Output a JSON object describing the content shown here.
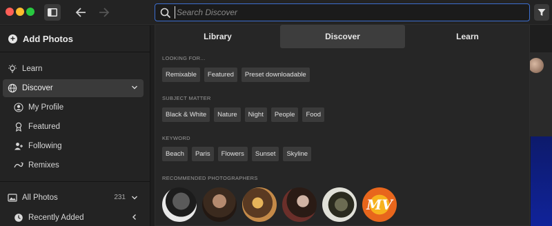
{
  "window": {
    "search_placeholder": "Search Discover"
  },
  "sidebar": {
    "add_photos": "Add Photos",
    "items": [
      {
        "label": "Learn",
        "icon": "lightbulb-icon"
      },
      {
        "label": "Discover",
        "icon": "globe-icon"
      },
      {
        "label": "My Profile",
        "icon": "profile-icon"
      },
      {
        "label": "Featured",
        "icon": "award-icon"
      },
      {
        "label": "Following",
        "icon": "person-add-icon"
      },
      {
        "label": "Remixes",
        "icon": "remix-icon"
      }
    ],
    "all_photos": {
      "label": "All Photos",
      "count": "231"
    },
    "recently_added": {
      "label": "Recently Added"
    }
  },
  "popover": {
    "tabs": [
      "Library",
      "Discover",
      "Learn"
    ],
    "active_tab": "Discover",
    "sections": {
      "looking_for": {
        "label": "LOOKING FOR...",
        "chips": [
          "Remixable",
          "Featured",
          "Preset downloadable"
        ]
      },
      "subject_matter": {
        "label": "SUBJECT MATTER",
        "chips": [
          "Black & White",
          "Nature",
          "Night",
          "People",
          "Food"
        ]
      },
      "keyword": {
        "label": "KEYWORD",
        "chips": [
          "Beach",
          "Paris",
          "Flowers",
          "Sunset",
          "Skyline"
        ]
      },
      "recommended": {
        "label": "RECOMMENDED PHOTOGRAPHERS",
        "logo_text": "MV"
      }
    }
  },
  "colors": {
    "accent_focus": "#3d6fd1",
    "active_tab_bg": "#3d3d3d",
    "chip_bg": "#3b3b3b"
  }
}
